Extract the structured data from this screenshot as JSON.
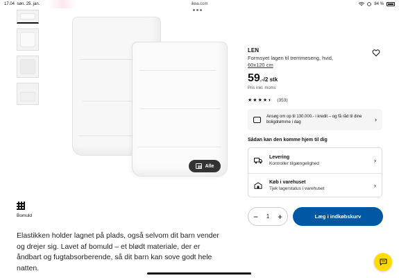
{
  "status_bar": {
    "time": "17.04",
    "date": "søn. 25. jan.",
    "url": "ikea.com",
    "battery": "84 %"
  },
  "gallery": {
    "thumbnail_count": 4,
    "all_button_label": "Alle"
  },
  "material": {
    "label": "Bomuld",
    "icon": "grid-weave-icon"
  },
  "description": "Elastikken holder lagnet på plads, også selvom dit barn vender og drejer sig. Lavet af bomuld – et blødt materiale, der er åndbart og fugtabsorberende, så dit barn kan sove godt hele natten.",
  "product": {
    "name": "LEN",
    "description": "Formsyet lagen til tremmeseng, hvid,",
    "size": "60x120 cm",
    "price_main": "59",
    "price_suffix": ".-/2 stk",
    "price_note": "Pris inkl. moms",
    "rating_stars": 4.5,
    "rating_count": "(353)"
  },
  "credit": {
    "text": "Ansøg om op til 130.000.- i kredit – og få råd til dine boligdrømme i dag",
    "icon": "credit-card-hand-icon"
  },
  "delivery": {
    "title": "Sådan kan den komme hjem til dig",
    "options": [
      {
        "title": "Levering",
        "subtitle": "Kontroller tilgængelighed",
        "icon": "truck-icon"
      },
      {
        "title": "Køb i varehuset",
        "subtitle": "Tjek lagerstatus i varehuset",
        "icon": "store-icon"
      }
    ]
  },
  "cart": {
    "quantity": "1",
    "minus": "−",
    "plus": "+",
    "add_label": "Læg i indkøbskurv"
  },
  "colors": {
    "primary_blue": "#0058a3",
    "chat_yellow": "#ffdb00"
  }
}
